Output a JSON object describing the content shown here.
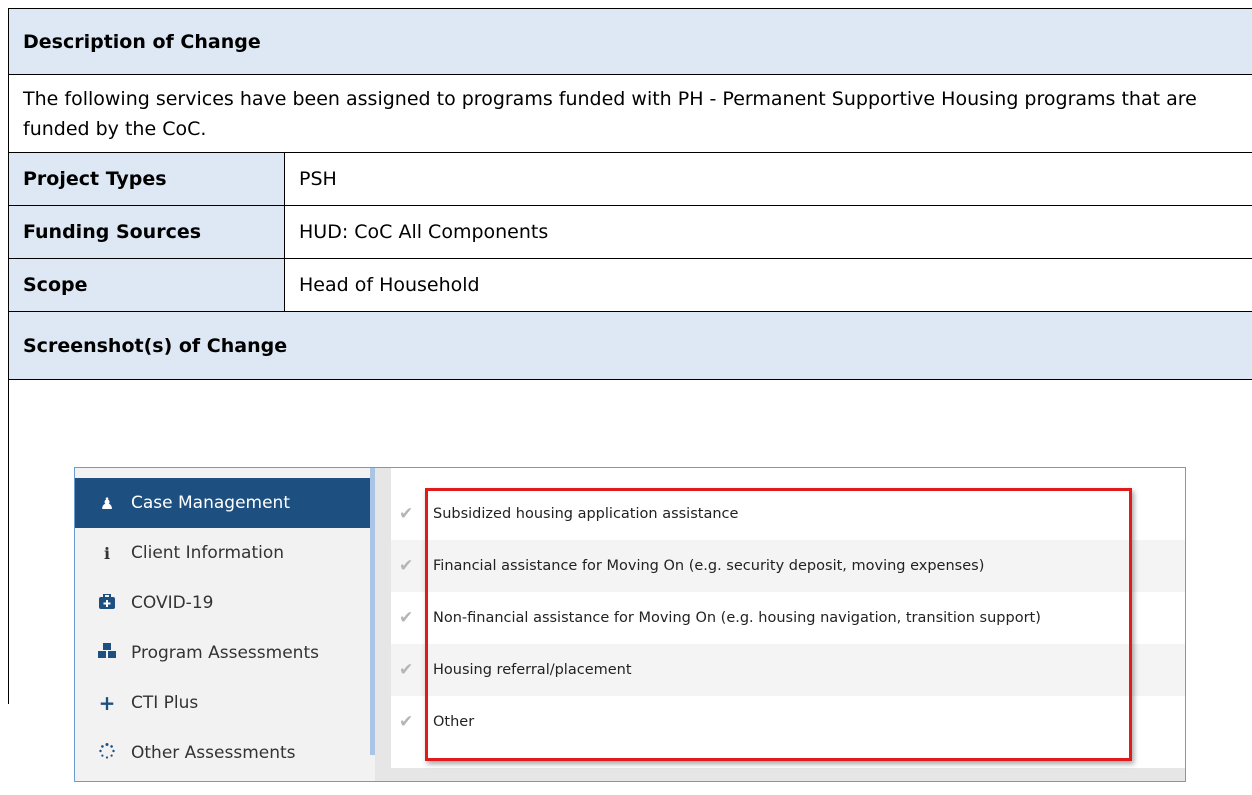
{
  "table": {
    "description_header": "Description of Change",
    "description_text": "The following services have been assigned to programs funded with PH - Permanent Supportive Housing programs that are funded by the CoC.",
    "rows": [
      {
        "label": "Project Types",
        "value": "PSH"
      },
      {
        "label": "Funding Sources",
        "value": "HUD: CoC All Components"
      },
      {
        "label": "Scope",
        "value": "Head of Household"
      }
    ],
    "screenshot_header": "Screenshot(s) of Change"
  },
  "screenshot": {
    "sidebar": {
      "items": [
        {
          "label": "Case Management",
          "icon": "person-icon",
          "active": true
        },
        {
          "label": "Client Information",
          "icon": "info-icon",
          "active": false
        },
        {
          "label": "COVID-19",
          "icon": "medical-kit-icon",
          "active": false
        },
        {
          "label": "Program Assessments",
          "icon": "cubes-icon",
          "active": false
        },
        {
          "label": "CTI Plus",
          "icon": "plus-icon",
          "active": false
        },
        {
          "label": "Other Assessments",
          "icon": "spinner-icon",
          "active": false
        }
      ]
    },
    "services": [
      "Subsidized housing application assistance",
      "Financial assistance for Moving On (e.g. security deposit, moving expenses)",
      "Non-financial assistance for Moving On (e.g. housing navigation, transition support)",
      "Housing referral/placement",
      "Other"
    ],
    "colors": {
      "active_nav": "#1d4f80",
      "header_fill": "#dde8f4",
      "highlight_border": "#e01b1b"
    }
  }
}
